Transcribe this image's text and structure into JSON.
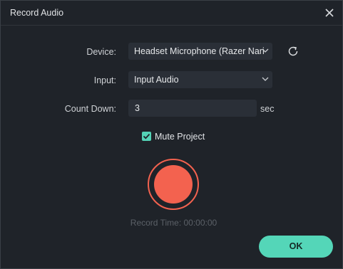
{
  "dialog": {
    "title": "Record Audio",
    "close_icon": "close-icon"
  },
  "form": {
    "device": {
      "label": "Device:",
      "value": "Headset Microphone (Razer Nari"
    },
    "input": {
      "label": "Input:",
      "value": "Input Audio"
    },
    "countdown": {
      "label": "Count Down:",
      "value": "3",
      "unit": "sec"
    },
    "mute_project": {
      "label": "Mute Project",
      "checked": true
    }
  },
  "record": {
    "time_label": "Record Time: 00:00:00"
  },
  "ok_label": "OK",
  "colors": {
    "accent": "#54d6b8",
    "record": "#f3624f",
    "background": "#1f2329"
  }
}
